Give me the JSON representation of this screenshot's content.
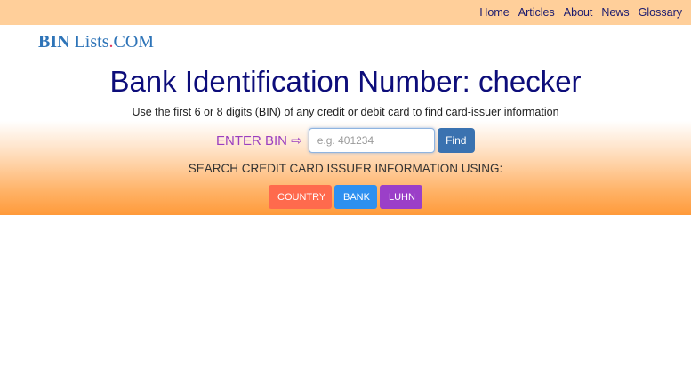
{
  "nav": {
    "items": [
      "Home",
      "Articles",
      "About",
      "News",
      "Glossary"
    ]
  },
  "logo": {
    "part1": "BIN",
    "part2": "Lists",
    "dot": ".",
    "part3": "COM"
  },
  "hero": {
    "title": "Bank Identification Number: checker",
    "subtitle": "Use the first 6 or 8 digits (BIN) of any credit or debit card to find card-issuer information"
  },
  "bin_form": {
    "label": "ENTER BIN ⇨",
    "placeholder": "e.g. 401234",
    "value": "",
    "button": "Find"
  },
  "search_using": {
    "heading": "SEARCH CREDIT CARD ISSUER INFORMATION USING:",
    "buttons": [
      "COUNTRY",
      "BANK",
      "LUHN"
    ]
  },
  "colors": {
    "nav_bg": "#ffcf9a",
    "title": "#0d0d7a",
    "logo": "#2e74b8",
    "bin_label": "#9b3fc0",
    "find_button": "#3a72b0",
    "country_button": "#ff6a4d",
    "bank_button": "#2e90f0",
    "luhn_button": "#9b3fc8"
  }
}
